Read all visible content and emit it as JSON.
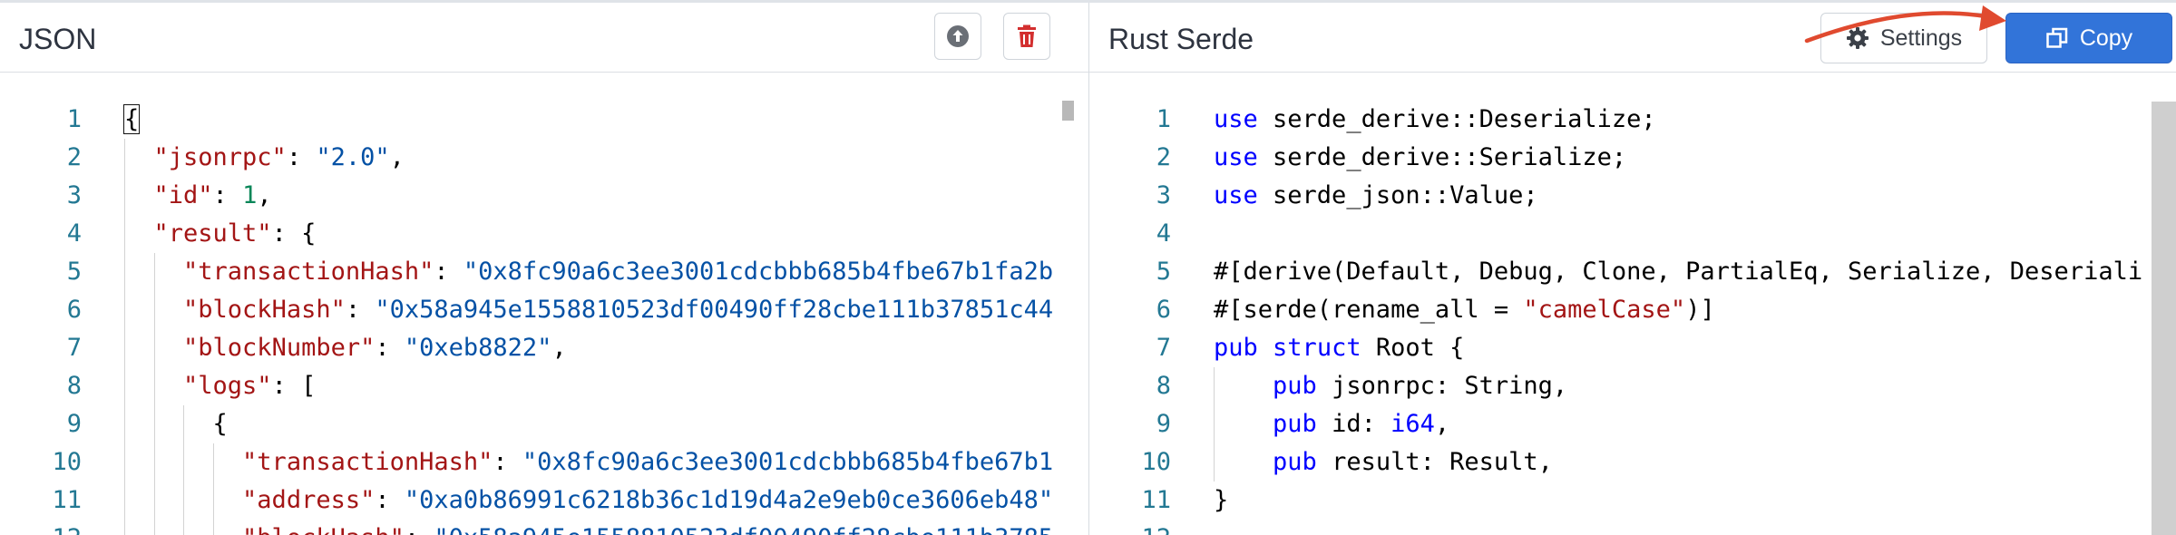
{
  "left_panel": {
    "title": "JSON",
    "buttons": [
      {
        "icon": "upload-circle-icon"
      },
      {
        "icon": "trash-icon"
      }
    ],
    "line_numbers": [
      "1",
      "2",
      "3",
      "4",
      "5",
      "6",
      "7",
      "8",
      "9",
      "10",
      "11",
      "12"
    ],
    "lines": [
      [
        {
          "t": "{",
          "c": "p"
        }
      ],
      [
        {
          "t": "  "
        },
        {
          "t": "\"jsonrpc\"",
          "c": "key"
        },
        {
          "t": ": "
        },
        {
          "t": "\"2.0\"",
          "c": "str"
        },
        {
          "t": ","
        }
      ],
      [
        {
          "t": "  "
        },
        {
          "t": "\"id\"",
          "c": "key"
        },
        {
          "t": ": "
        },
        {
          "t": "1",
          "c": "num"
        },
        {
          "t": ","
        }
      ],
      [
        {
          "t": "  "
        },
        {
          "t": "\"result\"",
          "c": "key"
        },
        {
          "t": ": {"
        }
      ],
      [
        {
          "t": "    "
        },
        {
          "t": "\"transactionHash\"",
          "c": "key"
        },
        {
          "t": ": "
        },
        {
          "t": "\"0x8fc90a6c3ee3001cdcbbb685b4fbe67b1fa2b",
          "c": "str"
        }
      ],
      [
        {
          "t": "    "
        },
        {
          "t": "\"blockHash\"",
          "c": "key"
        },
        {
          "t": ": "
        },
        {
          "t": "\"0x58a945e1558810523df00490ff28cbe111b37851c44",
          "c": "str"
        }
      ],
      [
        {
          "t": "    "
        },
        {
          "t": "\"blockNumber\"",
          "c": "key"
        },
        {
          "t": ": "
        },
        {
          "t": "\"0xeb8822\"",
          "c": "str"
        },
        {
          "t": ","
        }
      ],
      [
        {
          "t": "    "
        },
        {
          "t": "\"logs\"",
          "c": "key"
        },
        {
          "t": ": ["
        }
      ],
      [
        {
          "t": "      {"
        }
      ],
      [
        {
          "t": "        "
        },
        {
          "t": "\"transactionHash\"",
          "c": "key"
        },
        {
          "t": ": "
        },
        {
          "t": "\"0x8fc90a6c3ee3001cdcbbb685b4fbe67b1",
          "c": "str"
        }
      ],
      [
        {
          "t": "        "
        },
        {
          "t": "\"address\"",
          "c": "key"
        },
        {
          "t": ": "
        },
        {
          "t": "\"0xa0b86991c6218b36c1d19d4a2e9eb0ce3606eb48\"",
          "c": "str"
        }
      ],
      [
        {
          "t": "        "
        },
        {
          "t": "\"blockHash\"",
          "c": "key"
        },
        {
          "t": ": "
        },
        {
          "t": "\"0x58a945e1558810523df00490ff28cbe111b3785",
          "c": "str"
        }
      ]
    ]
  },
  "right_panel": {
    "title": "Rust Serde",
    "settings_label": "Settings",
    "copy_label": "Copy",
    "line_numbers": [
      "1",
      "2",
      "3",
      "4",
      "5",
      "6",
      "7",
      "8",
      "9",
      "10",
      "11",
      "12"
    ],
    "lines": [
      [
        {
          "t": "use",
          "c": "kw"
        },
        {
          "t": " serde_derive::Deserialize;"
        }
      ],
      [
        {
          "t": "use",
          "c": "kw"
        },
        {
          "t": " serde_derive::Serialize;"
        }
      ],
      [
        {
          "t": "use",
          "c": "kw"
        },
        {
          "t": " serde_json::Value;"
        }
      ],
      [],
      [
        {
          "t": "#[derive(Default, Debug, Clone, PartialEq, Serialize, Deseriali"
        }
      ],
      [
        {
          "t": "#[serde(rename_all = "
        },
        {
          "t": "\"camelCase\"",
          "c": "key"
        },
        {
          "t": ")]"
        }
      ],
      [
        {
          "t": "pub",
          "c": "kw"
        },
        {
          "t": " "
        },
        {
          "t": "struct",
          "c": "kw"
        },
        {
          "t": " Root {"
        }
      ],
      [
        {
          "t": "    "
        },
        {
          "t": "pub",
          "c": "kw"
        },
        {
          "t": " jsonrpc: String,"
        }
      ],
      [
        {
          "t": "    "
        },
        {
          "t": "pub",
          "c": "kw"
        },
        {
          "t": " id: "
        },
        {
          "t": "i64",
          "c": "kw"
        },
        {
          "t": ","
        }
      ],
      [
        {
          "t": "    "
        },
        {
          "t": "pub",
          "c": "kw"
        },
        {
          "t": " result: Result,"
        }
      ],
      [
        {
          "t": "}"
        }
      ],
      []
    ]
  },
  "colors": {
    "accent": "#3274d9",
    "arrow": "#e04a2f",
    "delete": "#d32f2f"
  }
}
